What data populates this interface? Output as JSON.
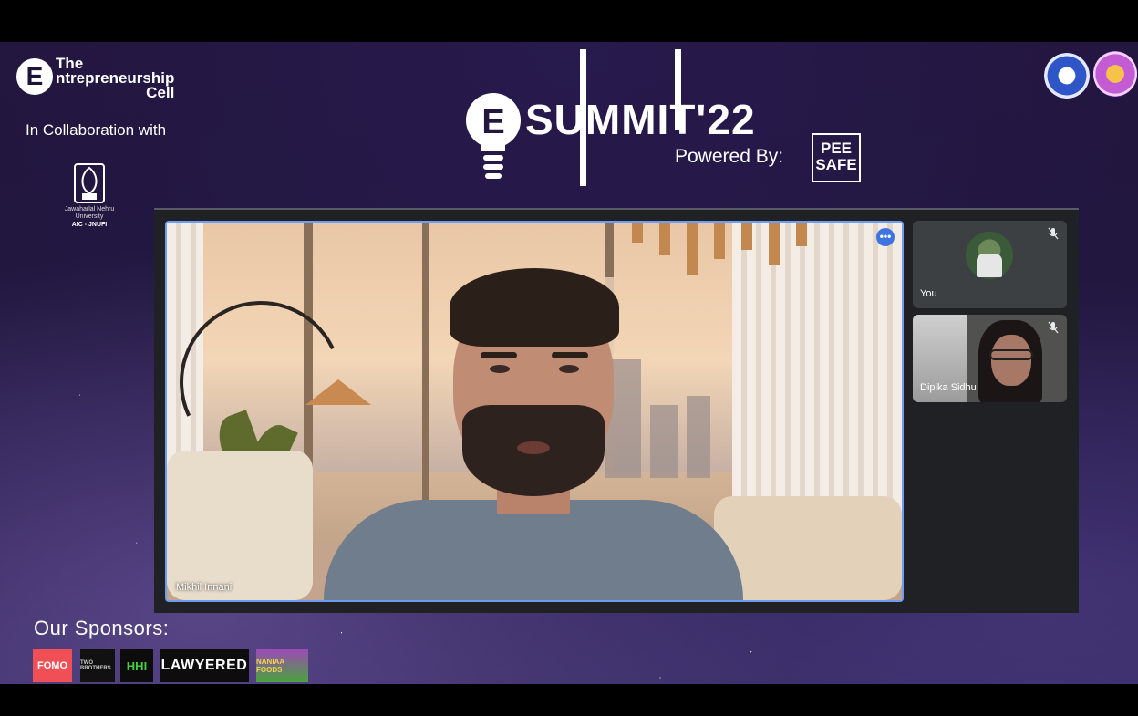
{
  "branding": {
    "ecell_badge": "E",
    "ecell_line1": "The",
    "ecell_line2": "ntrepreneurship",
    "ecell_line3": "Cell",
    "collab_text": "In Collaboration with",
    "jnu_emblem_text": "JNU",
    "jnu_name": "Jawaharlal Nehru University",
    "jnu_aic": "AIC - JNUFI"
  },
  "header": {
    "summit_title": "SUMMIT'22",
    "summit_badge": "E",
    "powered_by": "Powered By:",
    "sponsor_logo_line1": "PEE",
    "sponsor_logo_line2": "SAFE"
  },
  "meeting": {
    "main_participant": "Mikhil Innani",
    "more_options_icon": "•••",
    "participants": [
      {
        "name": "You",
        "muted": true
      },
      {
        "name": "Dipika Sidhu",
        "muted": true
      }
    ]
  },
  "footer": {
    "sponsors_title": "Our Sponsors:",
    "sponsors": [
      "FOMO",
      "TWO BROTHERS",
      "HHI",
      "LAWYERED",
      "NANIAA FOODS"
    ]
  },
  "colors": {
    "background": "#23163f",
    "meet_stage": "#202124",
    "active_speaker_border": "#6e9ef3"
  }
}
